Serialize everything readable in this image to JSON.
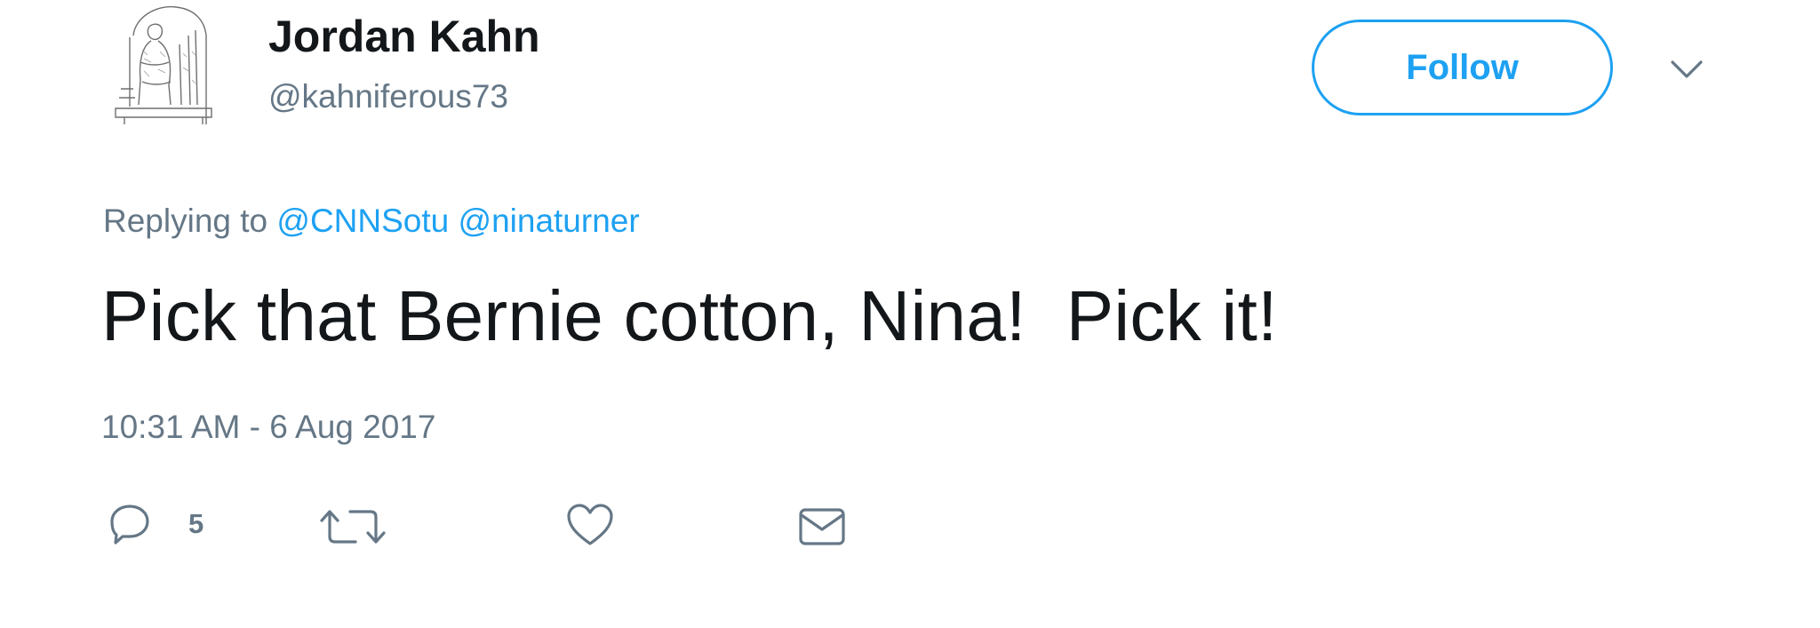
{
  "tweet": {
    "author": {
      "display_name": "Jordan Kahn",
      "handle": "@kahniferous73",
      "avatar_icon": "statue-sketch-avatar"
    },
    "follow_label": "Follow",
    "menu_icon": "chevron-down-icon",
    "reply_context": {
      "prefix": "Replying to",
      "mentions": [
        "@CNNSotu",
        "@ninaturner"
      ]
    },
    "text": "Pick that Bernie cotton, Nina!  Pick it!",
    "timestamp": "10:31 AM - 6 Aug 2017",
    "actions": {
      "reply": {
        "icon": "reply-icon",
        "count": "5"
      },
      "retweet": {
        "icon": "retweet-icon"
      },
      "like": {
        "icon": "heart-icon"
      },
      "message": {
        "icon": "envelope-icon"
      }
    }
  },
  "colors": {
    "accent": "#1da1f2",
    "text_primary": "#14171a",
    "text_secondary": "#657786"
  }
}
